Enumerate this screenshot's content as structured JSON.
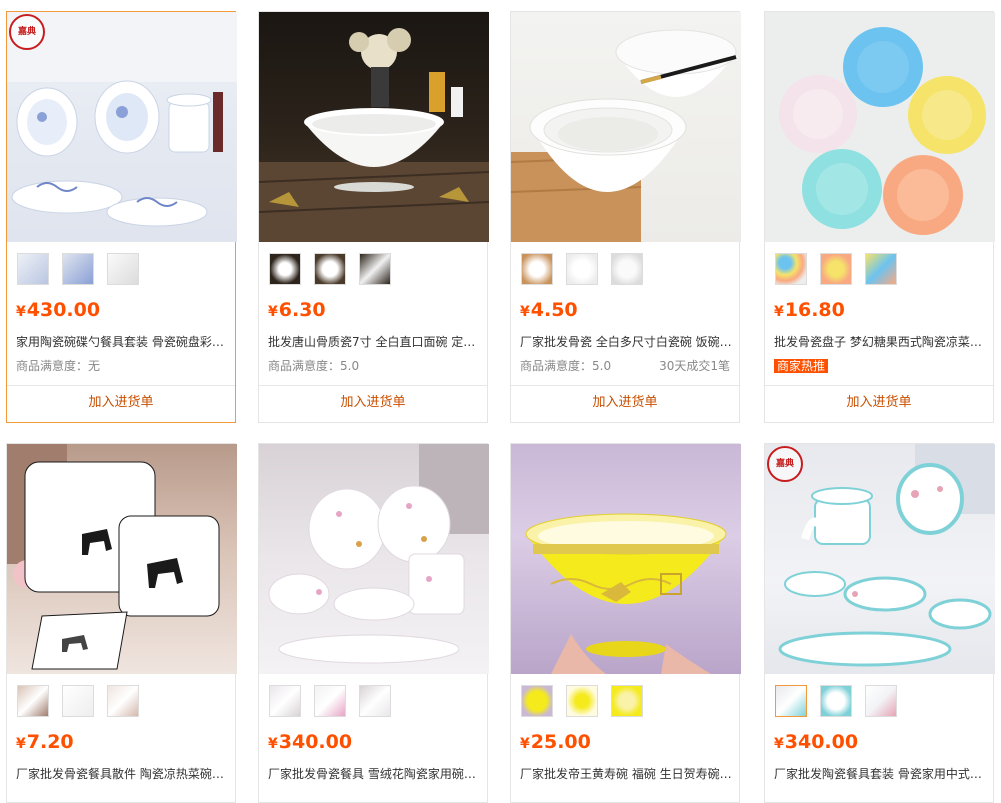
{
  "currency": "¥",
  "add_label": "加入进货单",
  "logo_text": "嘉典",
  "products": [
    {
      "price": "430.00",
      "title": "家用陶瓷碗碟勺餐具套装 骨瓷碗盘彩…",
      "satisfaction": "商品满意度：无",
      "sold": "",
      "badge": ""
    },
    {
      "price": "6.30",
      "title": "批发唐山骨质瓷7寸 全白直口面碗 定…",
      "satisfaction": "商品满意度：5.0",
      "sold": "",
      "badge": ""
    },
    {
      "price": "4.50",
      "title": "厂家批发骨瓷 全白多尺寸白瓷碗 饭碗…",
      "satisfaction": "商品满意度：5.0",
      "sold": "30天成交1笔",
      "badge": ""
    },
    {
      "price": "16.80",
      "title": "批发骨瓷盘子 梦幻糖果西式陶瓷凉菜…",
      "satisfaction": "",
      "sold": "",
      "badge": "商家热推"
    },
    {
      "price": "7.20",
      "title": "厂家批发骨瓷餐具散件 陶瓷凉热菜碗…"
    },
    {
      "price": "340.00",
      "title": "厂家批发骨瓷餐具 雪绒花陶瓷家用碗…"
    },
    {
      "price": "25.00",
      "title": "厂家批发帝王黄寿碗 福碗 生日贺寿碗…"
    },
    {
      "price": "340.00",
      "title": "厂家批发陶瓷餐具套装 骨瓷家用中式…"
    }
  ]
}
